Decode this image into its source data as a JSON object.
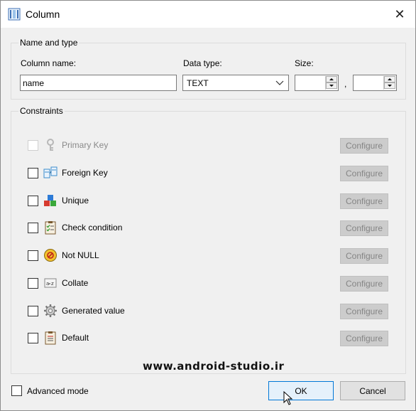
{
  "window": {
    "title": "Column",
    "title_icon": "column-table-icon",
    "close_glyph": "✕"
  },
  "name_and_type": {
    "legend": "Name and type",
    "column_name_label": "Column name:",
    "column_name_value": "name",
    "data_type_label": "Data type:",
    "data_type_value": "TEXT",
    "size_label": "Size:",
    "size_value_1": "",
    "size_separator": ",",
    "size_value_2": ""
  },
  "constraints": {
    "legend": "Constraints",
    "items": [
      {
        "label": "Primary Key",
        "icon": "key-icon",
        "enabled": false,
        "checked": false,
        "button": "Configure"
      },
      {
        "label": "Foreign Key",
        "icon": "foreign-key-icon",
        "enabled": true,
        "checked": false,
        "button": "Configure"
      },
      {
        "label": "Unique",
        "icon": "unique-blocks-icon",
        "enabled": true,
        "checked": false,
        "button": "Configure"
      },
      {
        "label": "Check condition",
        "icon": "checklist-icon",
        "enabled": true,
        "checked": false,
        "button": "Configure"
      },
      {
        "label": "Not NULL",
        "icon": "not-null-icon",
        "enabled": true,
        "checked": false,
        "button": "Configure"
      },
      {
        "label": "Collate",
        "icon": "collate-icon",
        "enabled": true,
        "checked": false,
        "button": "Configure"
      },
      {
        "label": "Generated value",
        "icon": "gear-icon",
        "enabled": true,
        "checked": false,
        "button": "Configure"
      },
      {
        "label": "Default",
        "icon": "clipboard-icon",
        "enabled": true,
        "checked": false,
        "button": "Configure"
      }
    ]
  },
  "watermark": "www.android-studio.ir",
  "footer": {
    "advanced_mode_label": "Advanced mode",
    "advanced_mode_checked": false,
    "ok_label": "OK",
    "cancel_label": "Cancel"
  },
  "colors": {
    "ok_border": "#0078d7",
    "ok_background": "#e5f1fb",
    "configure_disabled_bg": "#cccccc"
  }
}
